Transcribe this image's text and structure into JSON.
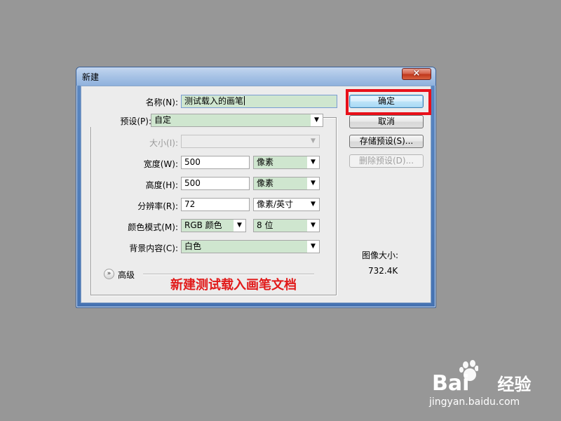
{
  "dialog": {
    "title": "新建",
    "close_label": "×",
    "name_label": "名称(N):",
    "name_value": "测试载入的画笔",
    "preset_label": "预设(P):",
    "preset_value": "自定",
    "size_label": "大小(I):",
    "size_value": "",
    "width_label": "宽度(W):",
    "width_value": "500",
    "width_unit": "像素",
    "height_label": "高度(H):",
    "height_value": "500",
    "height_unit": "像素",
    "resolution_label": "分辨率(R):",
    "resolution_value": "72",
    "resolution_unit": "像素/英寸",
    "color_mode_label": "颜色模式(M):",
    "color_mode_value": "RGB 颜色",
    "bit_depth_value": "8 位",
    "background_label": "背景内容(C):",
    "background_value": "白色",
    "advanced_label": "高级",
    "image_size_label": "图像大小:",
    "image_size_value": "732.4K"
  },
  "buttons": {
    "ok": "确定",
    "cancel": "取消",
    "save_preset": "存储预设(S)...",
    "delete_preset": "删除预设(D)..."
  },
  "annotation": "新建测试载入画笔文档",
  "watermark": {
    "brand": "Bai",
    "brand_suffix": "经验",
    "url": "jingyan.baidu.com"
  },
  "colors": {
    "background": "#979797",
    "highlight": "#e8101a",
    "annotation": "#e11a1a",
    "field_green": "#cfe6cf"
  },
  "icons": {
    "dropdown": "triangle-down",
    "advanced": "double-chevron-down",
    "close": "x-mark",
    "watermark": "paw-print"
  }
}
